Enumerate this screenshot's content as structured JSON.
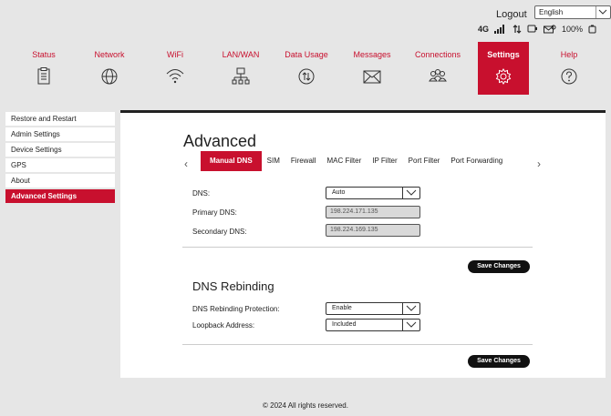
{
  "header": {
    "logout_label": "Logout",
    "language_value": "English",
    "network_type": "4G",
    "battery": "100%"
  },
  "nav": {
    "items": [
      {
        "label": "Status",
        "icon": "clipboard-icon"
      },
      {
        "label": "Network",
        "icon": "globe-icon"
      },
      {
        "label": "WiFi",
        "icon": "wifi-icon"
      },
      {
        "label": "LAN/WAN",
        "icon": "lan-icon"
      },
      {
        "label": "Data Usage",
        "icon": "data-usage-icon"
      },
      {
        "label": "Messages",
        "icon": "envelope-icon"
      },
      {
        "label": "Connections",
        "icon": "users-icon"
      },
      {
        "label": "Settings",
        "icon": "gear-icon"
      },
      {
        "label": "Help",
        "icon": "help-icon"
      }
    ],
    "active": "Settings"
  },
  "sidebar": {
    "items": [
      {
        "label": "Restore and Restart"
      },
      {
        "label": "Admin Settings"
      },
      {
        "label": "Device Settings"
      },
      {
        "label": "GPS"
      },
      {
        "label": "About"
      },
      {
        "label": "Advanced Settings"
      }
    ],
    "active": "Advanced Settings"
  },
  "main": {
    "title": "Advanced",
    "tabs": [
      {
        "label": "Manual DNS"
      },
      {
        "label": "SIM"
      },
      {
        "label": "Firewall"
      },
      {
        "label": "MAC Filter"
      },
      {
        "label": "IP Filter"
      },
      {
        "label": "Port Filter"
      },
      {
        "label": "Port Forwarding"
      }
    ],
    "active_tab": "Manual DNS",
    "dns": {
      "dns_label": "DNS:",
      "dns_value": "Auto",
      "primary_label": "Primary DNS:",
      "primary_value": "198.224.171.135",
      "secondary_label": "Secondary DNS:",
      "secondary_value": "198.224.169.135",
      "save_label": "Save Changes"
    },
    "rebinding": {
      "title": "DNS Rebinding",
      "protection_label": "DNS Rebinding Protection:",
      "protection_value": "Enable",
      "loopback_label": "Loopback Address:",
      "loopback_value": "Included",
      "save_label": "Save Changes"
    }
  },
  "footer": {
    "text": "© 2024 All rights reserved."
  },
  "colors": {
    "accent": "#c8102e",
    "background": "#e6e6e6",
    "panel": "#ffffff"
  }
}
